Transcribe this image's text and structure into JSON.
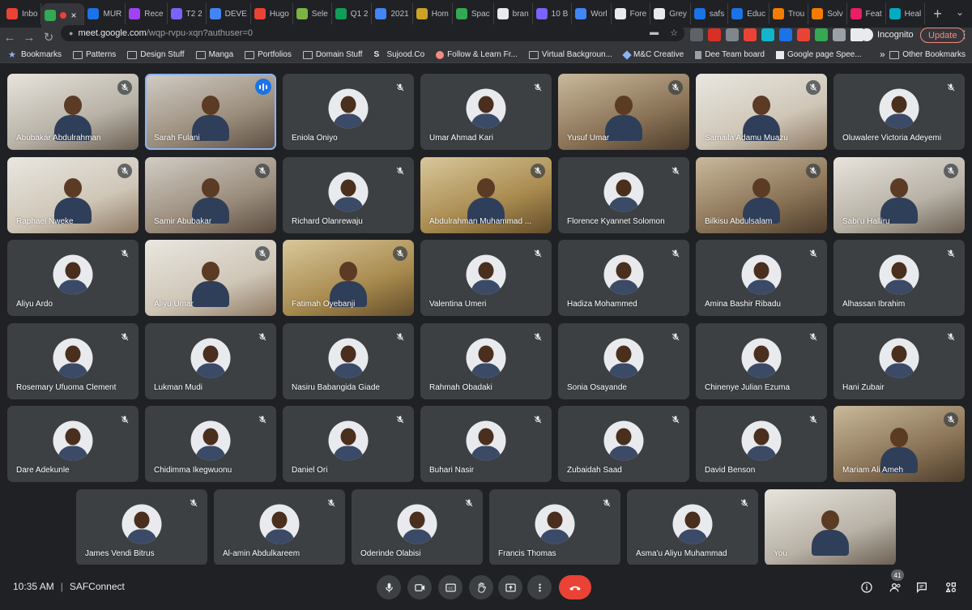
{
  "browser": {
    "tabs": [
      {
        "label": "Inbo",
        "color": "#ea4335"
      },
      {
        "label": "",
        "color": "#34a853",
        "active": true
      },
      {
        "label": "MUR",
        "color": "#1a73e8"
      },
      {
        "label": "Rece",
        "color": "#a142f4"
      },
      {
        "label": "T2 2",
        "color": "#7b61ff"
      },
      {
        "label": "DEVE",
        "color": "#4285f4"
      },
      {
        "label": "Hugo",
        "color": "#ea4335"
      },
      {
        "label": "Sele",
        "color": "#7cb342"
      },
      {
        "label": "Q1 2",
        "color": "#0f9d58"
      },
      {
        "label": "2021",
        "color": "#4285f4"
      },
      {
        "label": "Hom",
        "color": "#c9a227"
      },
      {
        "label": "Spac",
        "color": "#34a853"
      },
      {
        "label": "bran",
        "color": "#e8eaed"
      },
      {
        "label": "10 B",
        "color": "#7b61ff"
      },
      {
        "label": "Worl",
        "color": "#4285f4"
      },
      {
        "label": "Fore",
        "color": "#e8eaed"
      },
      {
        "label": "Grey",
        "color": "#e8eaed"
      },
      {
        "label": "safs",
        "color": "#1a73e8"
      },
      {
        "label": "Educ",
        "color": "#1a73e8"
      },
      {
        "label": "Trou",
        "color": "#f57c00"
      },
      {
        "label": "Solv",
        "color": "#f57c00"
      },
      {
        "label": "Feat",
        "color": "#e91e63"
      },
      {
        "label": "Heal",
        "color": "#00acc1"
      }
    ],
    "new_tab_icon": "+",
    "url_host": "meet.google.com",
    "url_path": "/wqp-rvpu-xqn?authuser=0",
    "incognito_label": "Incognito",
    "update_label": "Update",
    "bookmarks": [
      {
        "label": "Bookmarks",
        "icon": "star-icon"
      },
      {
        "label": "Patterns",
        "icon": "folder-icon"
      },
      {
        "label": "Design Stuff",
        "icon": "folder-icon"
      },
      {
        "label": "Manga",
        "icon": "folder-icon"
      },
      {
        "label": "Portfolios",
        "icon": "folder-icon"
      },
      {
        "label": "Domain Stuff",
        "icon": "folder-icon"
      },
      {
        "label": "Sujood.Co",
        "icon": "s-icon"
      },
      {
        "label": "Follow & Learn Fr...",
        "icon": "circle-icon"
      },
      {
        "label": "Virtual Backgroun...",
        "icon": "folder-icon"
      },
      {
        "label": "M&C Creative",
        "icon": "diamond-icon"
      },
      {
        "label": "Dee Team board",
        "icon": "board-icon"
      },
      {
        "label": "Google page Spee...",
        "icon": "page-icon"
      }
    ],
    "bookmarks_more": "»",
    "other_bookmarks": "Other Bookmarks"
  },
  "meet": {
    "rows": [
      [
        {
          "name": "Abubakar Abdulrahman",
          "type": "video",
          "style": "v1"
        },
        {
          "name": "Sarah Fulani",
          "type": "video",
          "style": "v2",
          "speaking": true
        },
        {
          "name": "Eniola Oniyo",
          "type": "avatar"
        },
        {
          "name": "Umar Ahmad Kari",
          "type": "avatar"
        },
        {
          "name": "Yusuf Umar",
          "type": "video",
          "style": "v3"
        },
        {
          "name": "Samaila Adamu Muazu",
          "type": "video",
          "style": "v4"
        },
        {
          "name": "Oluwalere Victoria Adeyemi",
          "type": "avatar"
        }
      ],
      [
        {
          "name": "Raphael Nweke",
          "type": "video",
          "style": "v4"
        },
        {
          "name": "Samir Abubakar",
          "type": "video",
          "style": "v2"
        },
        {
          "name": "Richard Olanrewaju",
          "type": "avatar"
        },
        {
          "name": "Abdulrahman Muhammad ...",
          "type": "video",
          "style": "v5"
        },
        {
          "name": "Florence Kyannet Solomon",
          "type": "avatar"
        },
        {
          "name": "Bilkisu Abdulsalam",
          "type": "video",
          "style": "v3"
        },
        {
          "name": "Sabi'u Halliru",
          "type": "video",
          "style": "v1"
        }
      ],
      [
        {
          "name": "Aliyu Ardo",
          "type": "avatar"
        },
        {
          "name": "Aliyu Umar",
          "type": "video",
          "style": "v4"
        },
        {
          "name": "Fatimah Oyebanji",
          "type": "video",
          "style": "v5"
        },
        {
          "name": "Valentina Umeri",
          "type": "avatar"
        },
        {
          "name": "Hadiza Mohammed",
          "type": "avatar"
        },
        {
          "name": "Amina Bashir Ribadu",
          "type": "avatar"
        },
        {
          "name": "Alhassan Ibrahim",
          "type": "avatar"
        }
      ],
      [
        {
          "name": "Rosemary Ufuoma Clement",
          "type": "avatar"
        },
        {
          "name": "Lukman Mudi",
          "type": "avatar"
        },
        {
          "name": "Nasiru Babangida Giade",
          "type": "avatar"
        },
        {
          "name": "Rahmah Obadaki",
          "type": "avatar"
        },
        {
          "name": "Sonia Osayande",
          "type": "avatar"
        },
        {
          "name": "Chinenye Julian Ezuma",
          "type": "avatar"
        },
        {
          "name": "Hani Zubair",
          "type": "avatar"
        }
      ],
      [
        {
          "name": "Dare Adekunle",
          "type": "avatar"
        },
        {
          "name": "Chidimma Ikegwuonu",
          "type": "avatar"
        },
        {
          "name": "Daniel Ori",
          "type": "avatar"
        },
        {
          "name": "Buhari Nasir",
          "type": "avatar"
        },
        {
          "name": "Zubaidah Saad",
          "type": "avatar"
        },
        {
          "name": "David Benson",
          "type": "avatar"
        },
        {
          "name": "Mariam Ali Ameh",
          "type": "video",
          "style": "v3"
        }
      ],
      [
        {
          "name": "James Vendi Bitrus",
          "type": "avatar"
        },
        {
          "name": "Al-amin Abdulkareem",
          "type": "avatar"
        },
        {
          "name": "Oderinde Olabisi",
          "type": "avatar"
        },
        {
          "name": "Francis Thomas",
          "type": "avatar"
        },
        {
          "name": "Asma'u Aliyu Muhammad",
          "type": "avatar"
        },
        {
          "name": "You",
          "type": "video",
          "style": "v1",
          "self": true
        }
      ]
    ],
    "time": "10:35 AM",
    "separator": "|",
    "meeting_name": "SAFConnect",
    "participant_count": "41",
    "colors": {
      "speaking_accent": "#8ab4f8",
      "hangup": "#ea4335",
      "tile_bg": "#3c4043"
    }
  }
}
